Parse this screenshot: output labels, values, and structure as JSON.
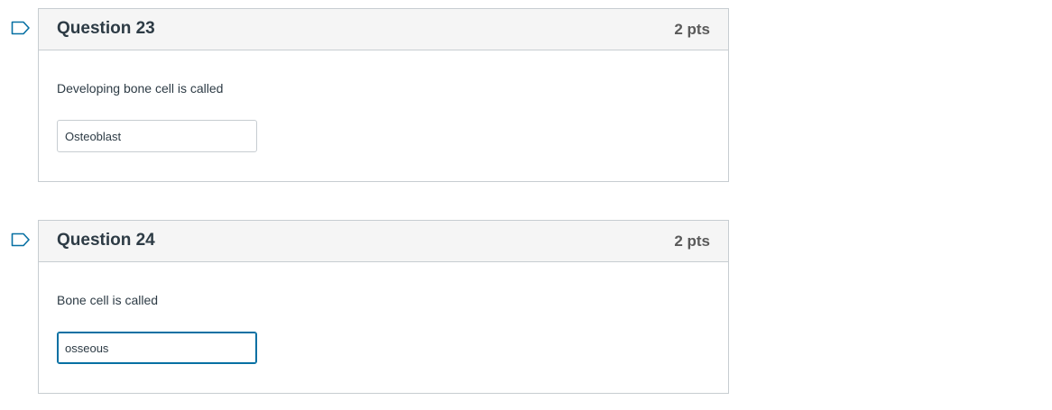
{
  "questions": [
    {
      "title": "Question 23",
      "points": "2 pts",
      "text": "Developing bone cell is called",
      "answer": "Osteoblast"
    },
    {
      "title": "Question 24",
      "points": "2 pts",
      "text": "Bone cell is called",
      "answer": "osseous"
    }
  ],
  "colors": {
    "accent": "#0770a3",
    "border": "#c7cdd1",
    "header_bg": "#f5f5f5"
  },
  "icons": {
    "flag": "bookmark-flag-icon"
  }
}
